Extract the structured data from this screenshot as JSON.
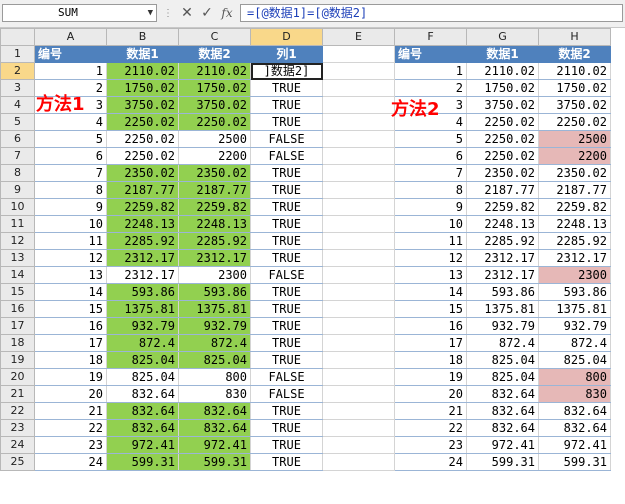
{
  "name_box": "SUM",
  "formula": "=[@数据1]=[@数据2]",
  "columns": [
    "A",
    "B",
    "C",
    "D",
    "E",
    "F",
    "G",
    "H"
  ],
  "headers": [
    "编号",
    "数据1",
    "数据2",
    "列1",
    "",
    "编号",
    "数据1",
    "数据2"
  ],
  "editing_text": "]数据2]",
  "labels": {
    "method1": "方法1",
    "method2": "方法2"
  },
  "rows": [
    {
      "n": "1",
      "d1": "2110.02",
      "d2": "2110.02",
      "r": "TRUE"
    },
    {
      "n": "2",
      "d1": "1750.02",
      "d2": "1750.02",
      "r": "TRUE"
    },
    {
      "n": "3",
      "d1": "3750.02",
      "d2": "3750.02",
      "r": "TRUE"
    },
    {
      "n": "4",
      "d1": "2250.02",
      "d2": "2250.02",
      "r": "TRUE"
    },
    {
      "n": "5",
      "d1": "2250.02",
      "d2": "2500",
      "r": "FALSE"
    },
    {
      "n": "6",
      "d1": "2250.02",
      "d2": "2200",
      "r": "FALSE"
    },
    {
      "n": "7",
      "d1": "2350.02",
      "d2": "2350.02",
      "r": "TRUE"
    },
    {
      "n": "8",
      "d1": "2187.77",
      "d2": "2187.77",
      "r": "TRUE"
    },
    {
      "n": "9",
      "d1": "2259.82",
      "d2": "2259.82",
      "r": "TRUE"
    },
    {
      "n": "10",
      "d1": "2248.13",
      "d2": "2248.13",
      "r": "TRUE"
    },
    {
      "n": "11",
      "d1": "2285.92",
      "d2": "2285.92",
      "r": "TRUE"
    },
    {
      "n": "12",
      "d1": "2312.17",
      "d2": "2312.17",
      "r": "TRUE"
    },
    {
      "n": "13",
      "d1": "2312.17",
      "d2": "2300",
      "r": "FALSE"
    },
    {
      "n": "14",
      "d1": "593.86",
      "d2": "593.86",
      "r": "TRUE"
    },
    {
      "n": "15",
      "d1": "1375.81",
      "d2": "1375.81",
      "r": "TRUE"
    },
    {
      "n": "16",
      "d1": "932.79",
      "d2": "932.79",
      "r": "TRUE"
    },
    {
      "n": "17",
      "d1": "872.4",
      "d2": "872.4",
      "r": "TRUE"
    },
    {
      "n": "18",
      "d1": "825.04",
      "d2": "825.04",
      "r": "TRUE"
    },
    {
      "n": "19",
      "d1": "825.04",
      "d2": "800",
      "r": "FALSE"
    },
    {
      "n": "20",
      "d1": "832.64",
      "d2": "830",
      "r": "FALSE"
    },
    {
      "n": "21",
      "d1": "832.64",
      "d2": "832.64",
      "r": "TRUE"
    },
    {
      "n": "22",
      "d1": "832.64",
      "d2": "832.64",
      "r": "TRUE"
    },
    {
      "n": "23",
      "d1": "972.41",
      "d2": "972.41",
      "r": "TRUE"
    },
    {
      "n": "24",
      "d1": "599.31",
      "d2": "599.31",
      "r": "TRUE"
    }
  ],
  "colors": {
    "header_blue": "#4f81bd",
    "match_green": "#92d050",
    "mismatch_pink": "#e6b8b7",
    "label_red": "#ff0000"
  }
}
